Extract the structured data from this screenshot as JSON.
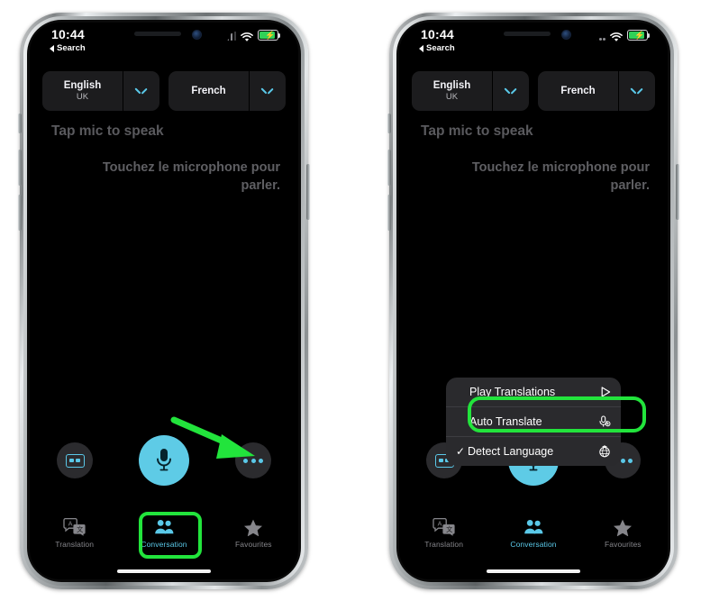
{
  "meta": {
    "background_color": "#ffffff",
    "accent_color": "#5ac8e8",
    "highlight_color": "#22e43c",
    "panel_color": "#1c1c1e"
  },
  "phones": [
    {
      "id": "left",
      "status_bar": {
        "time": "10:44",
        "back_label": "Search",
        "signal_icon": "cellular-bars-icon",
        "wifi_icon": "wifi-icon",
        "battery_icon": "battery-charging-icon"
      },
      "language_bar": {
        "source": {
          "name": "English",
          "region": "UK",
          "chevron_icon": "chevron-down-icon"
        },
        "target": {
          "name": "French",
          "region": "",
          "chevron_icon": "chevron-down-icon"
        }
      },
      "transcript": {
        "prompt": "Tap mic to speak",
        "translation": "Touchez le microphone pour parler."
      },
      "actions": {
        "captions_icon": "closed-captions-icon",
        "mic_icon": "microphone-icon",
        "more_icon": "more-ellipsis-icon"
      },
      "tabs": [
        {
          "label": "Translation",
          "icon": "translation-bubbles-icon",
          "active": false
        },
        {
          "label": "Conversation",
          "icon": "conversation-people-icon",
          "active": true
        },
        {
          "label": "Favourites",
          "icon": "star-icon",
          "active": false
        }
      ],
      "popup": null,
      "annotations": {
        "arrow": {
          "icon": "green-arrow-icon",
          "points_to": "more-ellipsis-icon"
        },
        "highlight": {
          "target": "tab-conversation"
        }
      }
    },
    {
      "id": "right",
      "status_bar": {
        "time": "10:44",
        "back_label": "Search",
        "signal_icon": "cellular-dots-icon",
        "wifi_icon": "wifi-icon",
        "battery_icon": "battery-charging-icon"
      },
      "language_bar": {
        "source": {
          "name": "English",
          "region": "UK",
          "chevron_icon": "chevron-down-icon"
        },
        "target": {
          "name": "French",
          "region": "",
          "chevron_icon": "chevron-down-icon"
        }
      },
      "transcript": {
        "prompt": "Tap mic to speak",
        "translation": "Touchez le microphone pour parler."
      },
      "actions": {
        "captions_icon": "closed-captions-icon",
        "mic_icon": "microphone-icon",
        "more_icon": "more-ellipsis-icon"
      },
      "tabs": [
        {
          "label": "Translation",
          "icon": "translation-bubbles-icon",
          "active": false
        },
        {
          "label": "Conversation",
          "icon": "conversation-people-icon",
          "active": true
        },
        {
          "label": "Favourites",
          "icon": "star-icon",
          "active": false
        }
      ],
      "popup": {
        "items": [
          {
            "label": "Play Translations",
            "icon": "play-triangle-icon",
            "checked": false
          },
          {
            "label": "Auto Translate",
            "icon": "mic-auto-icon",
            "checked": false
          },
          {
            "label": "Detect Language",
            "icon": "globe-translate-icon",
            "checked": true
          }
        ],
        "check_glyph": "✓"
      },
      "annotations": {
        "arrow": null,
        "highlight": {
          "target": "popup-item-auto-translate"
        }
      }
    }
  ]
}
